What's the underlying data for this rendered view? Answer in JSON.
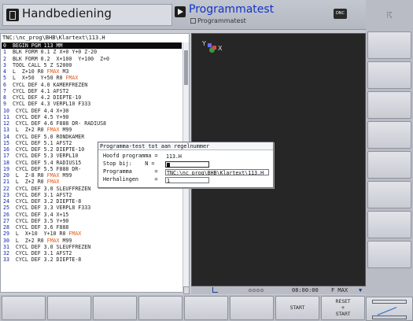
{
  "header": {
    "mode_left": "Handbediening",
    "mode_right_title": "Programmatest",
    "mode_right_sub": "Programmatest",
    "dnc_label": "DNC"
  },
  "program": {
    "path": "TNC:\\nc_prog\\BHB\\Klartext\\113.H",
    "lines": [
      {
        "n": "0",
        "text": "BEGIN PGM 113 MM",
        "sel": true
      },
      {
        "n": "1",
        "text": "BLK FORM 0.1 Z X+0 Y+0 Z-20"
      },
      {
        "n": "2",
        "text": "BLK FORM 0.2  X+100  Y+100  Z+0"
      },
      {
        "n": "3",
        "text": "TOOL CALL 5 Z S2000"
      },
      {
        "n": "4",
        "text": "L  Z+10 R0 FMAX M3"
      },
      {
        "n": "5",
        "text": "L  X+50  Y+50 R0 FMAX"
      },
      {
        "n": "6",
        "text": "CYCL DEF 4.0 KAMERFREZEN"
      },
      {
        "n": "7",
        "text": "CYCL DEF 4.1 AFST2"
      },
      {
        "n": "8",
        "text": "CYCL DEF 4.2 DIEPTE-10"
      },
      {
        "n": "9",
        "text": "CYCL DEF 4.3 VERPL10 F333"
      },
      {
        "n": "10",
        "text": "CYCL DEF 4.4 X+30"
      },
      {
        "n": "11",
        "text": "CYCL DEF 4.5 Y+90"
      },
      {
        "n": "12",
        "text": "CYCL DEF 4.6 F888 DR- RADIUS8"
      },
      {
        "n": "13",
        "text": "L  Z+2 R0 FMAX M99"
      },
      {
        "n": "14",
        "text": "CYCL DEF 5.0 RONDKAMER"
      },
      {
        "n": "15",
        "text": "CYCL DEF 5.1 AFST2"
      },
      {
        "n": "16",
        "text": "CYCL DEF 5.2 DIEPTE-10"
      },
      {
        "n": "17",
        "text": "CYCL DEF 5.3 VERPL10"
      },
      {
        "n": "18",
        "text": "CYCL DEF 5.4 RADIUS15"
      },
      {
        "n": "19",
        "text": "CYCL DEF 5.5 F888 DR-"
      },
      {
        "n": "20",
        "text": "L  Z-8 R0 FMAX M99"
      },
      {
        "n": "21",
        "text": "L  Z+2 R0 FMAX"
      },
      {
        "n": "22",
        "text": "CYCL DEF 3.0 SLEUFFREZEN"
      },
      {
        "n": "23",
        "text": "CYCL DEF 3.1 AFST2"
      },
      {
        "n": "24",
        "text": "CYCL DEF 3.2 DIEPTE-8"
      },
      {
        "n": "25",
        "text": "CYCL DEF 3.3 VERPL8 F333"
      },
      {
        "n": "26",
        "text": "CYCL DEF 3.4 X+15"
      },
      {
        "n": "27",
        "text": "CYCL DEF 3.5 Y+90"
      },
      {
        "n": "28",
        "text": "CYCL DEF 3.6 F888"
      },
      {
        "n": "29",
        "text": "L  X+10  Y+10 R0 FMAX"
      },
      {
        "n": "30",
        "text": "L  Z+2 R0 FMAX M99"
      },
      {
        "n": "31",
        "text": "CYCL DEF 3.0 SLEUFFREZEN"
      },
      {
        "n": "32",
        "text": "CYCL DEF 3.1 AFST2"
      },
      {
        "n": "33",
        "text": "CYCL DEF 3.2 DIEPTE-8"
      }
    ]
  },
  "dialog": {
    "title": "Programma-test tot aan regelnummer",
    "hoofd_label": "Hoofd programma =",
    "hoofd_value": "113.H",
    "stop_label": "Stop bij:    N =",
    "stop_value": "",
    "programma_label": "Programma       =",
    "programma_value": "TNC:\\nc_prog\\BHB\\Klartext\\113.H",
    "herhalingen_label": "Herhalingen     =",
    "herhalingen_value": "1"
  },
  "status": {
    "time": "08:00:00",
    "feed": "F MAX"
  },
  "softkeys": {
    "start": "START",
    "reset_start": "RESET\n+\nSTART"
  },
  "colors": {
    "line_number": "#0e1fa8",
    "keyword_fmax": "#e05a15",
    "title_blue": "#1234c8"
  }
}
